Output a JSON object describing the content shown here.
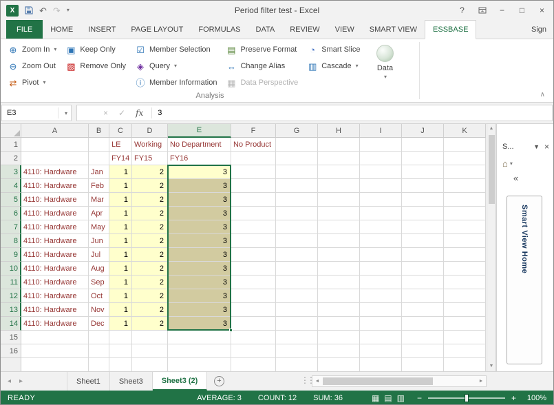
{
  "colors": {
    "accent_green": "#217346",
    "member_text": "#963634",
    "data_fill": "#FFFFCC",
    "selection_fill": "#D2CBA0"
  },
  "titlebar": {
    "title": "Period filter test - Excel"
  },
  "ribbon": {
    "tabs": [
      {
        "label": "FILE",
        "file": true
      },
      {
        "label": "HOME"
      },
      {
        "label": "INSERT"
      },
      {
        "label": "PAGE LAYOUT"
      },
      {
        "label": "FORMULAS"
      },
      {
        "label": "DATA"
      },
      {
        "label": "REVIEW"
      },
      {
        "label": "VIEW"
      },
      {
        "label": "SMART VIEW"
      },
      {
        "label": "ESSBASE",
        "active": true
      }
    ],
    "sign_label": "Sign",
    "group": {
      "label": "Analysis",
      "columns": [
        {
          "buttons": [
            {
              "label": "Zoom In",
              "icon": "zoom-in",
              "dropdown": true
            },
            {
              "label": "Zoom Out",
              "icon": "zoom-out"
            },
            {
              "label": "Pivot",
              "icon": "pivot",
              "dropdown": true
            }
          ]
        },
        {
          "buttons": [
            {
              "label": "Keep Only",
              "icon": "keep-only"
            },
            {
              "label": "Remove Only",
              "icon": "remove-only"
            }
          ]
        },
        {
          "buttons": [
            {
              "label": "Member Selection",
              "icon": "member-selection"
            },
            {
              "label": "Query",
              "icon": "query",
              "dropdown": true
            },
            {
              "label": "Member Information",
              "icon": "member-information"
            }
          ]
        },
        {
          "buttons": [
            {
              "label": "Preserve Format",
              "icon": "preserve-format"
            },
            {
              "label": "Change Alias",
              "icon": "change-alias"
            },
            {
              "label": "Data Perspective",
              "icon": "data-perspective",
              "disabled": true
            }
          ]
        },
        {
          "buttons": [
            {
              "label": "Smart Slice",
              "icon": "smart-slice"
            },
            {
              "label": "Cascade",
              "icon": "cascade",
              "dropdown": true
            }
          ]
        }
      ],
      "big_button": {
        "label": "Data",
        "icon": "data-sphere",
        "dropdown": true
      }
    }
  },
  "formula_bar": {
    "name_box": "E3",
    "fx_label": "fx",
    "formula": "3"
  },
  "grid": {
    "col_headers": [
      "A",
      "B",
      "C",
      "D",
      "E",
      "F",
      "G",
      "H",
      "I",
      "J",
      "K"
    ],
    "selection": {
      "range": "E3:E14",
      "col": "E",
      "row_from": 3,
      "row_to": 14,
      "active_cell": "E3",
      "active_row": 3
    },
    "rows": [
      {
        "n": 1,
        "cells": {
          "C": "LE",
          "D": "Working",
          "E": "No Department",
          "F": "No Product"
        }
      },
      {
        "n": 2,
        "cells": {
          "C": "FY14",
          "D": "FY15",
          "E": "FY16"
        }
      },
      {
        "n": 3,
        "cells": {
          "A": "4110: Hardware",
          "B": "Jan",
          "C": "1",
          "D": "2",
          "E": "3"
        }
      },
      {
        "n": 4,
        "cells": {
          "A": "4110: Hardware",
          "B": "Feb",
          "C": "1",
          "D": "2",
          "E": "3"
        }
      },
      {
        "n": 5,
        "cells": {
          "A": "4110: Hardware",
          "B": "Mar",
          "C": "1",
          "D": "2",
          "E": "3"
        }
      },
      {
        "n": 6,
        "cells": {
          "A": "4110: Hardware",
          "B": "Apr",
          "C": "1",
          "D": "2",
          "E": "3"
        }
      },
      {
        "n": 7,
        "cells": {
          "A": "4110: Hardware",
          "B": "May",
          "C": "1",
          "D": "2",
          "E": "3"
        }
      },
      {
        "n": 8,
        "cells": {
          "A": "4110: Hardware",
          "B": "Jun",
          "C": "1",
          "D": "2",
          "E": "3"
        }
      },
      {
        "n": 9,
        "cells": {
          "A": "4110: Hardware",
          "B": "Jul",
          "C": "1",
          "D": "2",
          "E": "3"
        }
      },
      {
        "n": 10,
        "cells": {
          "A": "4110: Hardware",
          "B": "Aug",
          "C": "1",
          "D": "2",
          "E": "3"
        }
      },
      {
        "n": 11,
        "cells": {
          "A": "4110: Hardware",
          "B": "Sep",
          "C": "1",
          "D": "2",
          "E": "3"
        }
      },
      {
        "n": 12,
        "cells": {
          "A": "4110: Hardware",
          "B": "Oct",
          "C": "1",
          "D": "2",
          "E": "3"
        }
      },
      {
        "n": 13,
        "cells": {
          "A": "4110: Hardware",
          "B": "Nov",
          "C": "1",
          "D": "2",
          "E": "3"
        }
      },
      {
        "n": 14,
        "cells": {
          "A": "4110: Hardware",
          "B": "Dec",
          "C": "1",
          "D": "2",
          "E": "3"
        }
      },
      {
        "n": 15,
        "cells": {}
      },
      {
        "n": 16,
        "cells": {}
      }
    ]
  },
  "pane": {
    "title": "S...",
    "vertical_button": "Smart View Home"
  },
  "sheet_tabs": {
    "tabs": [
      {
        "label": "Sheet1"
      },
      {
        "label": "Sheet3"
      },
      {
        "label": "Sheet3 (2)",
        "active": true
      }
    ],
    "add_label": "+"
  },
  "status_bar": {
    "mode": "READY",
    "stats": [
      "AVERAGE: 3",
      "COUNT: 12",
      "SUM: 36"
    ],
    "zoom_percent": "100%"
  }
}
